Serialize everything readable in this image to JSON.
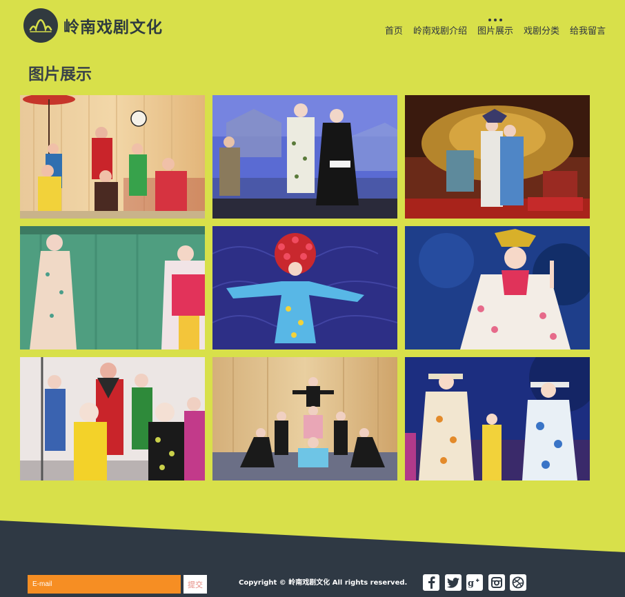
{
  "site": {
    "logo_text": "岭南戏剧文化"
  },
  "nav": {
    "items": [
      {
        "label": "首页"
      },
      {
        "label": "岭南戏剧介绍"
      },
      {
        "label": "图片展示"
      },
      {
        "label": "戏剧分类"
      },
      {
        "label": "给我留言"
      }
    ],
    "active_index": 2
  },
  "page": {
    "title": "图片展示"
  },
  "gallery": {
    "photos": [
      {
        "name": "opera-photo-1"
      },
      {
        "name": "opera-photo-2"
      },
      {
        "name": "opera-photo-3"
      },
      {
        "name": "opera-photo-4"
      },
      {
        "name": "opera-photo-5"
      },
      {
        "name": "opera-photo-6"
      },
      {
        "name": "opera-photo-7"
      },
      {
        "name": "opera-photo-8"
      },
      {
        "name": "opera-photo-9"
      }
    ]
  },
  "footer": {
    "email_placeholder": "E-mail",
    "submit_label": "提交",
    "copyright": "Copyright © 岭南戏剧文化 All rights reserved.",
    "socials": [
      "facebook-icon",
      "twitter-icon",
      "google-plus-icon",
      "instagram-icon",
      "dribbble-icon"
    ]
  },
  "colors": {
    "background": "#d8e04a",
    "footer": "#2f3944",
    "email_field": "#f68e23",
    "title_text": "#3a4248"
  }
}
